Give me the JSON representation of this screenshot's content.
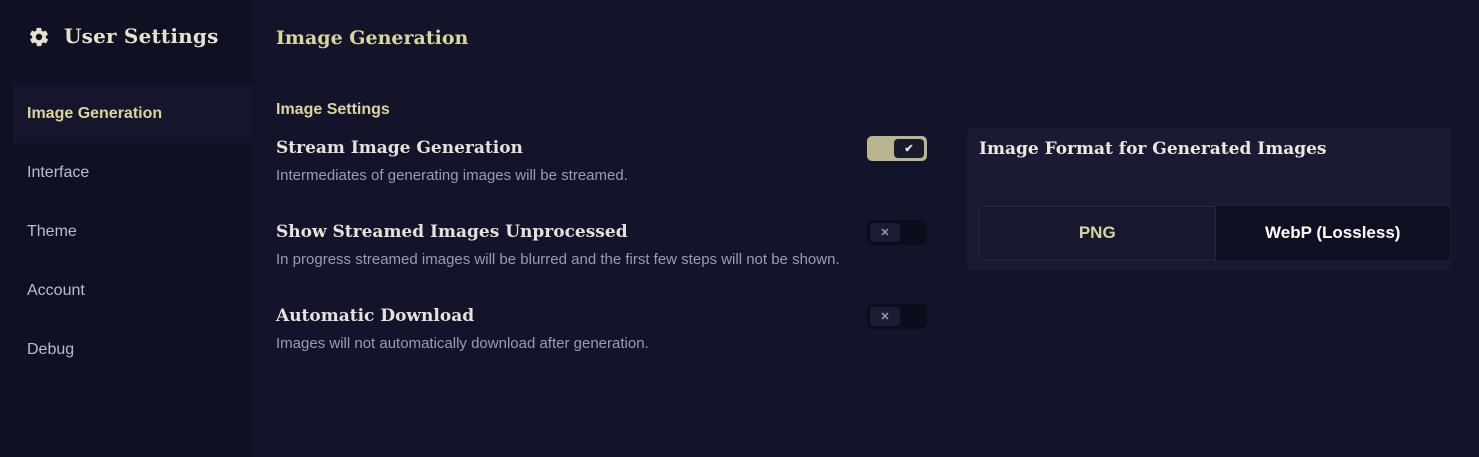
{
  "sidebar": {
    "title": "User Settings",
    "title_icon": "gear-icon",
    "items": [
      {
        "label": "Image Generation",
        "active": true
      },
      {
        "label": "Interface",
        "active": false
      },
      {
        "label": "Theme",
        "active": false
      },
      {
        "label": "Account",
        "active": false
      },
      {
        "label": "Debug",
        "active": false
      }
    ]
  },
  "main": {
    "title": "Image Generation",
    "section_label": "Image Settings",
    "settings": [
      {
        "title": "Stream Image Generation",
        "description": "Intermediates of generating images will be streamed.",
        "enabled": true,
        "toggle_glyph": "✔"
      },
      {
        "title": "Show Streamed Images Unprocessed",
        "description": "In progress streamed images will be blurred and the first few steps will not be shown.",
        "enabled": false,
        "toggle_glyph": "✕"
      },
      {
        "title": "Automatic Download",
        "description": "Images will not automatically download after generation.",
        "enabled": false,
        "toggle_glyph": "✕"
      }
    ],
    "format_card": {
      "title": "Image Format for Generated Images",
      "options": [
        "PNG",
        "WebP (Lossless)"
      ],
      "selected": "PNG"
    }
  },
  "colors": {
    "accent": "#d9d59d",
    "toggle_on": "#b9b68f",
    "background": "#13142a",
    "sidebar_bg": "#0f1021"
  }
}
